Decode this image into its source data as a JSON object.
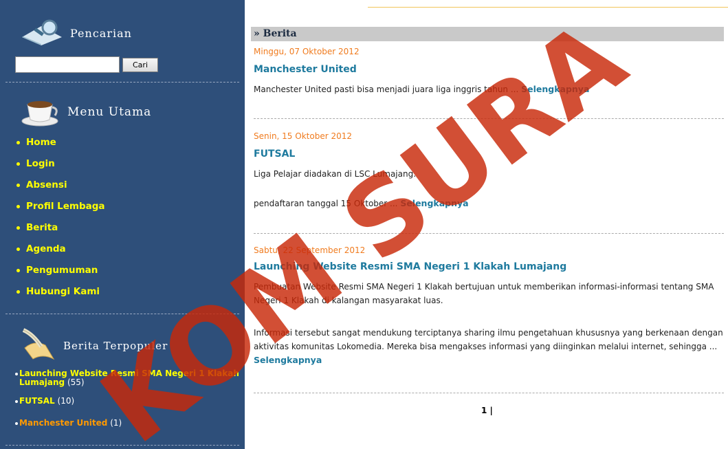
{
  "sidebar": {
    "search": {
      "heading": "Pencarian",
      "input_value": "",
      "button_label": "Cari"
    },
    "menu": {
      "heading": "Menu Utama",
      "items": [
        "Home",
        "Login",
        "Absensi",
        "Profil Lembaga",
        "Berita",
        "Agenda",
        "Pengumuman",
        "Hubungi Kami"
      ]
    },
    "popular": {
      "heading": "Berita Terpopuler",
      "items": [
        {
          "title": "Launching Website Resmi SMA Negeri 1 Klakah Lumajang",
          "count": "(55)"
        },
        {
          "title": "FUTSAL",
          "count": "(10)"
        },
        {
          "title": "Manchester United",
          "count": "(1)"
        }
      ]
    }
  },
  "main": {
    "section_title": "» Berita",
    "read_more": "Selengkapnya",
    "news": [
      {
        "date": "Minggu, 07 Oktober 2012",
        "title": "Manchester United",
        "paragraphs": [
          "Manchester United pasti bisa menjadi juara liga inggris tahun ..."
        ]
      },
      {
        "date": "Senin, 15 Oktober 2012",
        "title": "FUTSAL",
        "paragraphs": [
          "Liga Pelajar diadakan di LSC Lumajang.",
          "pendaftaran tanggal 15 Oktober ..."
        ]
      },
      {
        "date": "Sabtu, 22 September 2012",
        "title": "Launching Website Resmi SMA Negeri 1 Klakah Lumajang",
        "paragraphs": [
          "Pembuatan Website Resmi SMA Negeri 1 Klakah bertujuan untuk memberikan informasi-informasi tentang SMA Negeri 1 Klakah di kalangan masyarakat luas.",
          "Informasi tersebut sangat mendukung terciptanya sharing ilmu pengetahuan khususnya yang berkenaan dengan aktivitas komunitas Lokomedia. Mereka bisa mengakses informasi yang diinginkan melalui internet, sehingga ..."
        ]
      }
    ],
    "pagination": "1 |"
  },
  "watermark": "KOM SURA"
}
